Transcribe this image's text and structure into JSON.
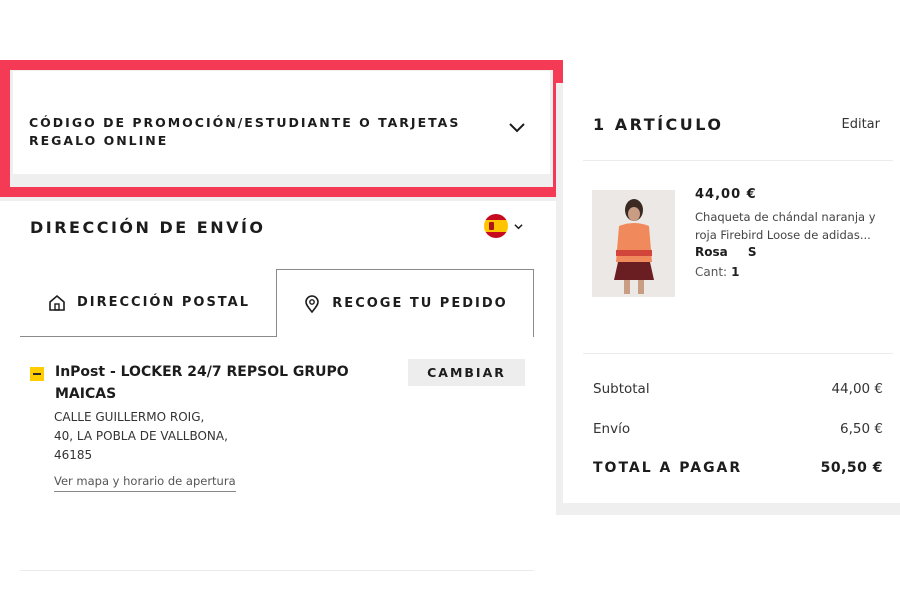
{
  "promo": {
    "label": "CÓDIGO DE PROMOCIÓN/ESTUDIANTE O TARJETAS REGALO ONLINE"
  },
  "shipping": {
    "title": "DIRECCIÓN DE ENVÍO",
    "country_flag": "spain-flag-icon",
    "tabs": [
      {
        "label": "DIRECCIÓN POSTAL",
        "icon": "house-icon",
        "selected": false
      },
      {
        "label": "RECOGE TU PEDIDO",
        "icon": "location-pin-icon",
        "selected": true
      }
    ],
    "pickup": {
      "name": "InPost - LOCKER 24/7 REPSOL GRUPO MAICAS",
      "change_label": "CAMBIAR",
      "address_line1": "CALLE GUILLERMO ROIG,",
      "address_line2": "40, LA POBLA DE VALLBONA,",
      "address_line3": "46185",
      "map_link": "Ver mapa y horario de apertura"
    }
  },
  "cart": {
    "title": "1 ARTÍCULO",
    "edit_label": "Editar",
    "item": {
      "price": "44,00 €",
      "name": "Chaqueta de chándal naranja y roja Firebird Loose de adidas...",
      "color": "Rosa",
      "size": "S",
      "qty_label": "Cant:",
      "qty": "1"
    },
    "summary": {
      "subtotal_label": "Subtotal",
      "subtotal_value": "44,00 €",
      "shipping_label": "Envío",
      "shipping_value": "6,50 €",
      "total_label": "TOTAL A PAGAR",
      "total_value": "50,50 €"
    }
  },
  "colors": {
    "highlight": "#f43a54",
    "inpost_yellow": "#ffcc00"
  }
}
